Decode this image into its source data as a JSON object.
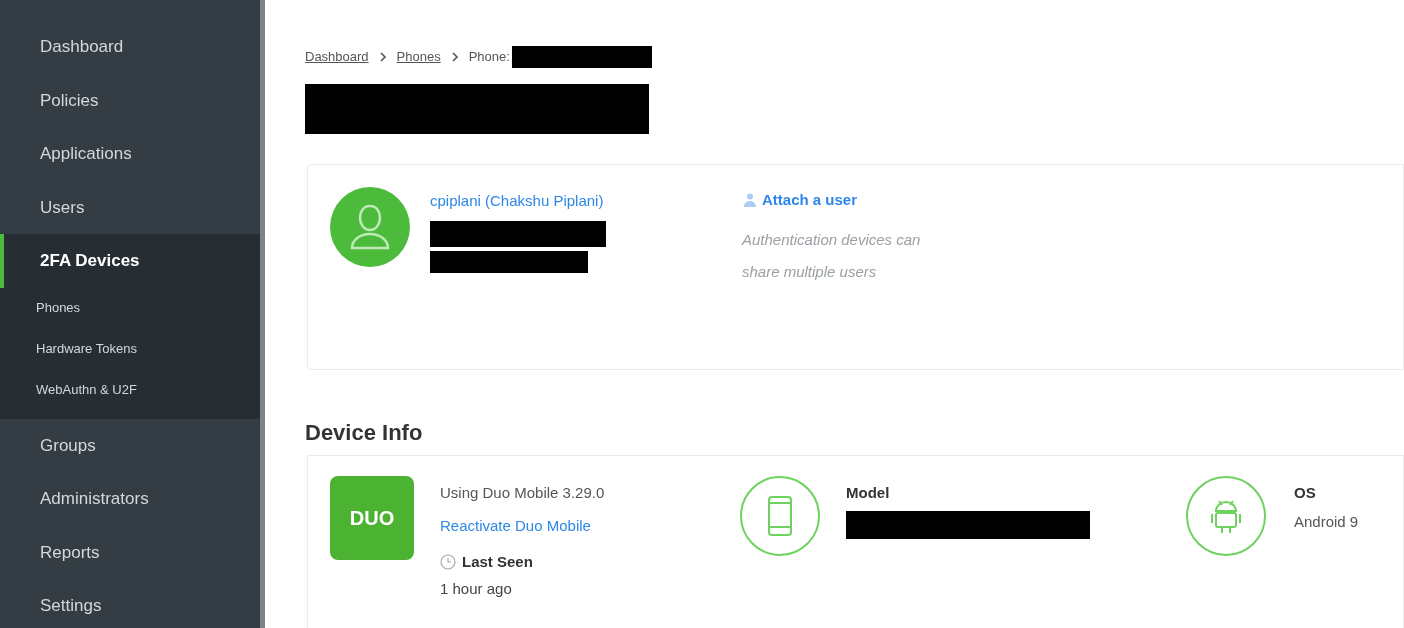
{
  "sidebar": {
    "items": [
      {
        "label": "Dashboard",
        "selected": false
      },
      {
        "label": "Policies",
        "selected": false
      },
      {
        "label": "Applications",
        "selected": false
      },
      {
        "label": "Users",
        "selected": false
      },
      {
        "label": "2FA Devices",
        "selected": true,
        "children": [
          {
            "label": "Phones",
            "selected": false
          },
          {
            "label": "Hardware Tokens",
            "selected": false
          },
          {
            "label": "WebAuthn & U2F",
            "selected": false
          }
        ]
      },
      {
        "label": "Groups",
        "selected": false
      },
      {
        "label": "Administrators",
        "selected": false
      },
      {
        "label": "Reports",
        "selected": false
      },
      {
        "label": "Settings",
        "selected": false
      }
    ]
  },
  "breadcrumb": [
    {
      "label": "Dashboard",
      "kind": "link"
    },
    {
      "label": "Phones",
      "kind": "link"
    },
    {
      "label": "Phone:",
      "kind": "current"
    }
  ],
  "user_card": {
    "user_link": "cpiplani (Chakshu Piplani)",
    "attach_link": "Attach a user",
    "help_text": "Authentication devices can share multiple users"
  },
  "device_info": {
    "heading": "Device Info",
    "app_logo": "DUO",
    "app_version": "Using Duo Mobile 3.29.0",
    "reactivate_link": "Reactivate Duo Mobile",
    "last_seen_label": "Last Seen",
    "last_seen_value": "1 hour ago",
    "model_label": "Model",
    "os_label": "OS",
    "os_value": "Android 9"
  }
}
